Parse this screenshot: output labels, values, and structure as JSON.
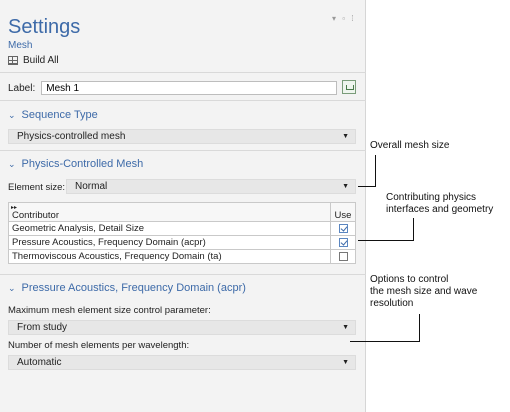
{
  "header": {
    "title": "Settings",
    "subtitle": "Mesh",
    "build_all": "Build All"
  },
  "label_field": {
    "label": "Label:",
    "value": "Mesh 1"
  },
  "sequence_type": {
    "section_title": "Sequence Type",
    "selected": "Physics-controlled mesh"
  },
  "physics_controlled": {
    "section_title": "Physics-Controlled Mesh",
    "element_size_label": "Element size:",
    "element_size_value": "Normal",
    "table": {
      "header_contributor": "Contributor",
      "header_use": "Use",
      "rows": [
        {
          "contributor": "Geometric Analysis, Detail Size",
          "use": true
        },
        {
          "contributor": "Pressure Acoustics, Frequency Domain (acpr)",
          "use": true
        },
        {
          "contributor": "Thermoviscous Acoustics, Frequency Domain (ta)",
          "use": false
        }
      ]
    }
  },
  "acpr": {
    "section_title": "Pressure Acoustics, Frequency Domain (acpr)",
    "max_size_label": "Maximum mesh element size control parameter:",
    "max_size_value": "From study",
    "per_wavelength_label": "Number of mesh elements per wavelength:",
    "per_wavelength_value": "Automatic"
  },
  "annotations": {
    "overall": "Overall mesh size",
    "contributing_line1": "Contributing physics",
    "contributing_line2": "interfaces and geometry",
    "options_line1": "Options to control",
    "options_line2": "the mesh size and wave",
    "options_line3": "resolution"
  },
  "icons": {
    "build": "build-all-icon",
    "label_action": "label-action-icon",
    "section_toggle": "chevron-down-icon",
    "dropdown": "dropdown-arrow-icon",
    "move": "move-icon"
  },
  "colors": {
    "accent": "#3d6aa8",
    "panel_bg": "#f3f3f3"
  }
}
